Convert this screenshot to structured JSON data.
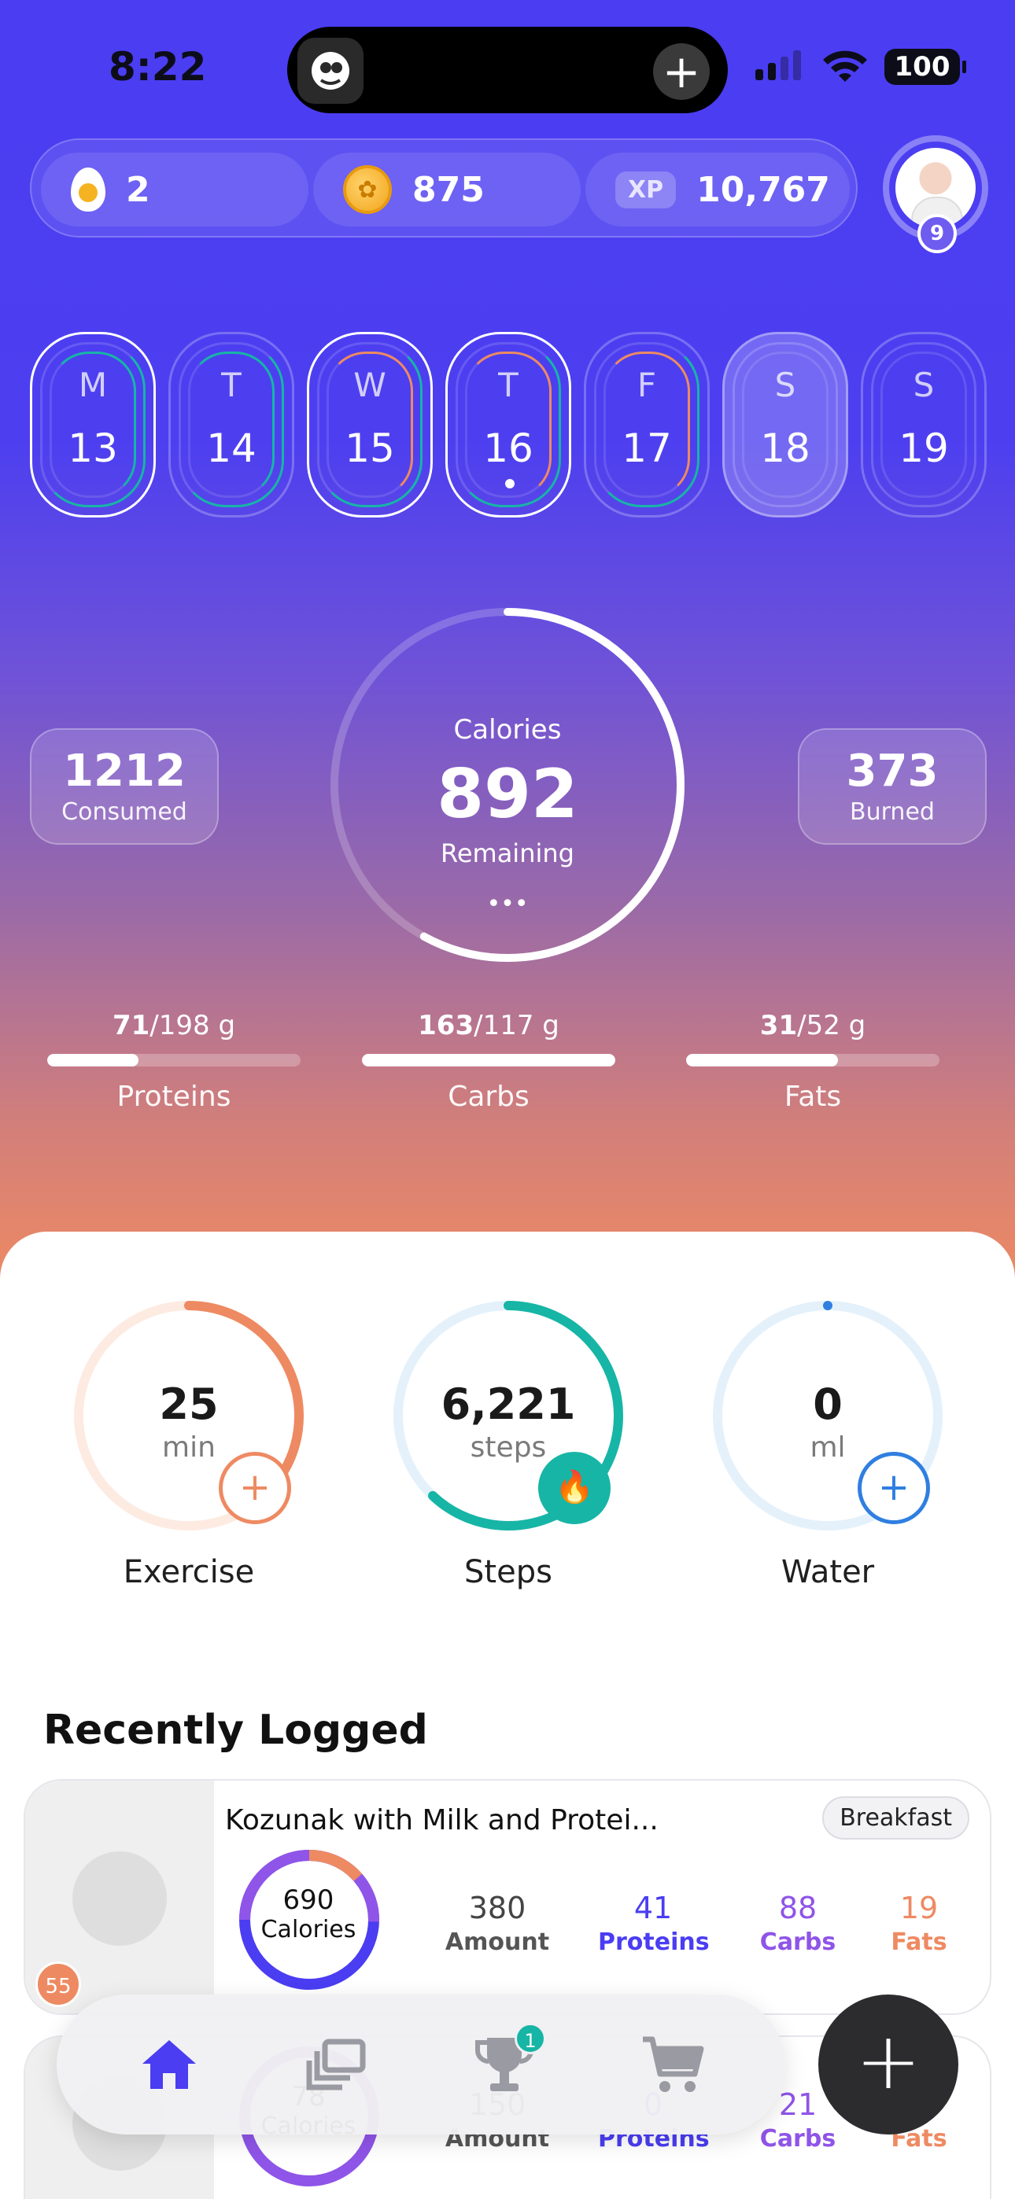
{
  "status": {
    "time": "8:22",
    "battery": "100"
  },
  "stats": {
    "eggs": "2",
    "coins": "875",
    "xp_label": "XP",
    "xp": "10,767",
    "level": "9"
  },
  "week": [
    {
      "letter": "M",
      "date": "13"
    },
    {
      "letter": "T",
      "date": "14"
    },
    {
      "letter": "W",
      "date": "15"
    },
    {
      "letter": "T",
      "date": "16"
    },
    {
      "letter": "F",
      "date": "17"
    },
    {
      "letter": "S",
      "date": "18"
    },
    {
      "letter": "S",
      "date": "19"
    }
  ],
  "calories": {
    "consumed": "1212",
    "consumed_label": "Consumed",
    "burned": "373",
    "burned_label": "Burned",
    "title": "Calories",
    "remaining": "892",
    "remaining_label": "Remaining",
    "more": "•••",
    "progress": 0.58
  },
  "macros": [
    {
      "current": "71",
      "target": "/198 g",
      "name": "Proteins",
      "fraction": 0.36
    },
    {
      "current": "163",
      "target": "/117 g",
      "name": "Carbs",
      "fraction": 1.0
    },
    {
      "current": "31",
      "target": "/52 g",
      "name": "Fats",
      "fraction": 0.6
    }
  ],
  "activity": [
    {
      "value": "25",
      "unit": "min",
      "label": "Exercise",
      "button": "+",
      "color": "#ee8a62",
      "track": "#fdebe2",
      "progress": 0.42
    },
    {
      "value": "6,221",
      "unit": "steps",
      "label": "Steps",
      "button": "🔥",
      "color": "#17b5a6",
      "track": "#e4f1fb",
      "progress": 0.62
    },
    {
      "value": "0",
      "unit": "ml",
      "label": "Water",
      "button": "+",
      "color": "#2f7fe0",
      "track": "#e4f1fb",
      "progress": 0
    }
  ],
  "recent": {
    "title": "Recently Logged",
    "items": [
      {
        "name": "Kozunak with Milk and Protei...",
        "tag": "Breakfast",
        "calories": "690",
        "calories_label": "Calories",
        "amount": "380",
        "amount_label": "Amount",
        "proteins": "41",
        "proteins_label": "Proteins",
        "carbs": "88",
        "carbs_label": "Carbs",
        "fats": "19",
        "fats_label": "Fats",
        "streak": "55"
      },
      {
        "name": "",
        "tag": "",
        "calories": "78",
        "calories_label": "Calories",
        "amount": "150",
        "amount_label": "Amount",
        "proteins": "0",
        "proteins_label": "Proteins",
        "carbs": "21",
        "carbs_label": "Carbs",
        "fats": "0",
        "fats_label": "Fats"
      }
    ]
  },
  "nav": {
    "trophy_badge": "1",
    "fab": "+"
  },
  "colors": {
    "purple": "#4a3df2",
    "proteins": "#4a3df2",
    "carbs": "#8f54e8",
    "fats": "#ee8a62"
  }
}
